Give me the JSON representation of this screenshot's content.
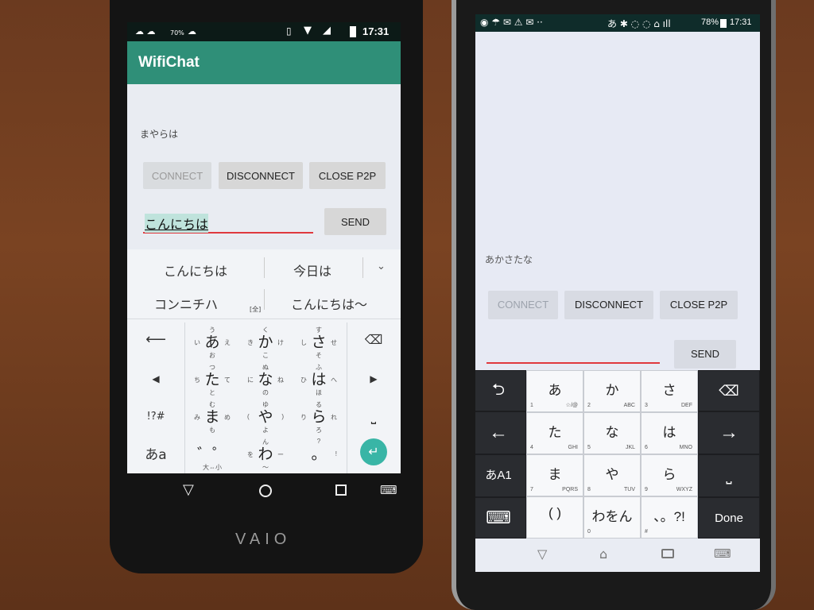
{
  "left_phone": {
    "status_bar": {
      "time": "17:31",
      "battery_text": "70%"
    },
    "app_title": "WifiChat",
    "received_text": "まやらは",
    "buttons": {
      "connect": "CONNECT",
      "disconnect": "DISCONNECT",
      "close_p2p": "CLOSE P2P",
      "send": "SEND"
    },
    "input_value": "こんにちは",
    "candidates": {
      "c1": "こんにちは",
      "c2": "今日は",
      "c3": "コンニチハ",
      "c3_tag": "[全]",
      "c4": "こんにちは〜"
    },
    "keyboard": {
      "keys": [
        {
          "main": "あ",
          "l": "い",
          "t": "う",
          "r": "え",
          "b": "お"
        },
        {
          "main": "か",
          "l": "き",
          "t": "く",
          "r": "け",
          "b": "こ"
        },
        {
          "main": "さ",
          "l": "し",
          "t": "す",
          "r": "せ",
          "b": "そ"
        },
        {
          "main": "た",
          "l": "ち",
          "t": "つ",
          "r": "て",
          "b": "と"
        },
        {
          "main": "な",
          "l": "に",
          "t": "ぬ",
          "r": "ね",
          "b": "の"
        },
        {
          "main": "は",
          "l": "ひ",
          "t": "ふ",
          "r": "へ",
          "b": "ほ"
        },
        {
          "main": "ま",
          "l": "み",
          "t": "む",
          "r": "め",
          "b": "も"
        },
        {
          "main": "や",
          "l": "(",
          "t": "ゆ",
          "r": ")",
          "b": "よ"
        },
        {
          "main": "ら",
          "l": "り",
          "t": "る",
          "r": "れ",
          "b": "ろ"
        },
        {
          "main": "゛゜",
          "l": "",
          "t": "",
          "r": "",
          "b": "大⇔小"
        },
        {
          "main": "わ",
          "l": "を",
          "t": "ん",
          "r": "ー",
          "b": "〜"
        },
        {
          "main": "。",
          "l": "",
          "t": "?",
          "r": "!",
          "b": ""
        }
      ],
      "symbols_label": "!?#",
      "mode_label": "あa"
    },
    "brand": "VAIO"
  },
  "right_phone": {
    "status_bar": {
      "time": "17:31",
      "battery_text": "78%"
    },
    "received_text": "あかさたな",
    "buttons": {
      "connect": "CONNECT",
      "disconnect": "DISCONNECT",
      "close_p2p": "CLOSE P2P",
      "send": "SEND"
    },
    "keyboard": {
      "keys": [
        {
          "main": "あ",
          "num": "1",
          "alt": "☆/@"
        },
        {
          "main": "か",
          "num": "2",
          "alt": "ABC"
        },
        {
          "main": "さ",
          "num": "3",
          "alt": "DEF"
        },
        {
          "main": "た",
          "num": "4",
          "alt": "GHI"
        },
        {
          "main": "な",
          "num": "5",
          "alt": "JKL"
        },
        {
          "main": "は",
          "num": "6",
          "alt": "MNO"
        },
        {
          "main": "ま",
          "num": "7",
          "alt": "PQRS"
        },
        {
          "main": "や",
          "num": "8",
          "alt": "TUV"
        },
        {
          "main": "ら",
          "num": "9",
          "alt": "WXYZ"
        },
        {
          "main": "( )",
          "num": "",
          "alt": ""
        },
        {
          "main": "わをん",
          "num": "0",
          "alt": ""
        },
        {
          "main": "、。?!",
          "num": "#",
          "alt": ""
        }
      ],
      "mode_label": "あA1",
      "done_label": "Done"
    }
  },
  "colors": {
    "app_bar": "#2f8f78",
    "accent_underline": "#e0393e",
    "enter_key": "#39b5a6"
  }
}
